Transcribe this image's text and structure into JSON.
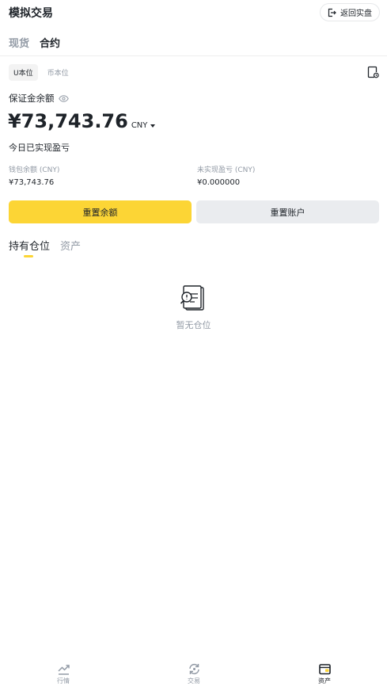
{
  "header": {
    "title": "模拟交易",
    "back_button_label": "返回实盘",
    "back_icon": "exit-icon"
  },
  "mode_tabs": [
    {
      "label": "现货",
      "active": false
    },
    {
      "label": "合约",
      "active": true
    }
  ],
  "unit_tabs": [
    {
      "label": "U本位",
      "active": true
    },
    {
      "label": "币本位",
      "active": false
    }
  ],
  "history_icon": "document-clock-icon",
  "balance": {
    "label": "保证金余额",
    "value": "¥73,743.76",
    "currency": "CNY",
    "pnl_today_label": "今日已实现盈亏"
  },
  "stats": {
    "wallet_label": "钱包余额 (CNY)",
    "wallet_value": "¥73,743.76",
    "unrealized_label": "未实现盈亏 (CNY)",
    "unrealized_value": "¥0.000000"
  },
  "buttons": {
    "reset_balance": "重置余额",
    "reset_account": "重置账户"
  },
  "position_tabs": [
    {
      "label": "持有仓位",
      "active": true
    },
    {
      "label": "资产",
      "active": false
    }
  ],
  "empty_state": {
    "text": "暂无仓位",
    "icon": "empty-document-icon"
  },
  "bottom_nav": [
    {
      "label": "行情",
      "icon": "chart-trend-icon",
      "active": false
    },
    {
      "label": "交易",
      "icon": "swap-icon",
      "active": false
    },
    {
      "label": "资产",
      "icon": "wallet-icon",
      "active": true
    }
  ],
  "colors": {
    "accent": "#fcd535",
    "text_primary": "#1e2329",
    "text_secondary": "#929aa5",
    "button_secondary": "#eaecef"
  }
}
